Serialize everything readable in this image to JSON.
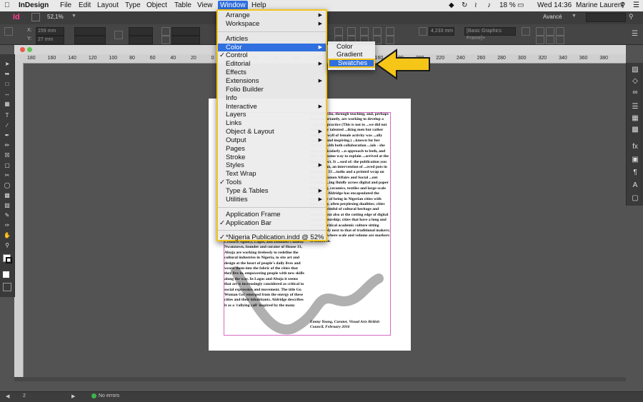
{
  "menubar": {
    "app": "InDesign",
    "items": [
      "File",
      "Edit",
      "Layout",
      "Type",
      "Object",
      "Table",
      "View",
      "Window",
      "Help"
    ],
    "battery": "18 %",
    "datetime": "Wed 14:36",
    "user": "Marine Laurent"
  },
  "appbar": {
    "logo": "Id",
    "zoom": "52,1%",
    "workspace": "Avancé"
  },
  "control": {
    "x": "159 mm",
    "y": "27 mm",
    "w_value": "4,233 mm",
    "style": "[Basic Graphics Frame]+"
  },
  "ruler_labels": [
    "180",
    "160",
    "140",
    "120",
    "100",
    "80",
    "60",
    "40",
    "20",
    "0",
    "20",
    "40",
    "60",
    "80",
    "100",
    "120",
    "140",
    "160",
    "180",
    "200",
    "220",
    "240",
    "260",
    "280",
    "300",
    "320",
    "340",
    "360",
    "380"
  ],
  "window_menu": {
    "items": [
      {
        "label": "Arrange",
        "submenu": true
      },
      {
        "label": "Workspace",
        "submenu": true
      },
      {
        "sep": true
      },
      {
        "label": "Articles"
      },
      {
        "label": "Color",
        "submenu": true,
        "highlighted": true
      },
      {
        "label": "Control",
        "checked": true
      },
      {
        "label": "Editorial",
        "submenu": true
      },
      {
        "label": "Effects"
      },
      {
        "label": "Extensions",
        "submenu": true
      },
      {
        "label": "Folio Builder"
      },
      {
        "label": "Info"
      },
      {
        "label": "Interactive",
        "submenu": true
      },
      {
        "label": "Layers"
      },
      {
        "label": "Links"
      },
      {
        "label": "Object & Layout",
        "submenu": true
      },
      {
        "label": "Output",
        "submenu": true
      },
      {
        "label": "Pages"
      },
      {
        "label": "Stroke"
      },
      {
        "label": "Styles",
        "submenu": true
      },
      {
        "label": "Text Wrap"
      },
      {
        "label": "Tools",
        "checked": true
      },
      {
        "label": "Type & Tables",
        "submenu": true
      },
      {
        "label": "Utilities",
        "submenu": true
      },
      {
        "sep": true
      },
      {
        "label": "Application Frame"
      },
      {
        "label": "Application Bar",
        "checked": true
      },
      {
        "sep": true
      },
      {
        "label": "*Nigeria Publication.indd @ 52%",
        "checked": true
      }
    ]
  },
  "color_menu": {
    "items": [
      "Color",
      "Gradient"
    ],
    "highlighted": "Swatches"
  },
  "document": {
    "left_column": "Creative Agency, Lagos, and Disinaeli Comedy Nwanzuwn, founder and curator of House 33, Abuja are working tirelessly to redefine the cultural industries in Nigeria, to site art and design at the heart of people's daily lives and weave them into the fabric of the cities that they live in, empowering people with new skills along the way. In Lagos and Abuja it seems that art is increasingly considered as critical to social expression and movement. The title Go Woman Go! emerged from the energy of these cities and their inhabitants. Aldridge describes it as a 'rallying call' inspired by the many",
    "right_column": "...we met who, through teaching, and, perhaps most importantly, are working to develop a ...ble arts practice (This is not to ...we did not meet many talented ...iking men but rather that the ...wyll of female activity was ...ally apparent and inspiring.) ...known for her expert- ...with both collaboration ...ials - she has a particularly ...n approach to both, and this ...ngs some way to explain ...arrived at the final project. It ...ssed of: the publication you ...ing, a film, an intervention of ...oved pots in the House 33 ...tudio and a printed wrap on the ...of Women Affairs and Social ...ent building. ...ing fluidly across digital and paper publishing, ceramics, textiles and large-scale sculpture, Aldridge has encapsulated the experience of being in Nigerian cities with their many, often perplexing dualities; cities that are brimful of cultural heritage and tradition but also at the cutting edge of digital entrepreneurship; cities that have a long and enviable critical academic culture sitting comfortably next to that of traditional makers; and cities where scale and volume are markers of ambition.",
    "signature": "Emmy Young, Curator, Visual Arts British Council, February 2016"
  },
  "statusbar": {
    "page": "2",
    "errors": "No errors"
  }
}
